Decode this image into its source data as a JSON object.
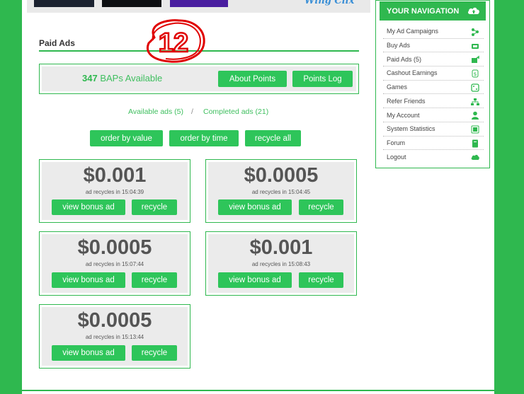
{
  "colors": {
    "brand": "#2fb84f",
    "button": "#2ec55a",
    "panel": "#ebebeb",
    "stamp": "#e00000"
  },
  "banner": {
    "logo_text": "Wing Clix"
  },
  "stamp_number": "12",
  "section": {
    "title": "Paid Ads"
  },
  "points": {
    "count": "347",
    "label": "BAPs Available",
    "about_button": "About Points",
    "log_button": "Points Log"
  },
  "filters": {
    "available": "Available ads (5)",
    "separator": "/",
    "completed": "Completed ads (21)"
  },
  "actions": {
    "order_value": "order by value",
    "order_time": "order by time",
    "recycle_all": "recycle all"
  },
  "ads": [
    {
      "value": "$0.001",
      "recycle_text": "ad recycles in 15:04:39",
      "view_label": "view bonus ad",
      "recycle_label": "recycle"
    },
    {
      "value": "$0.0005",
      "recycle_text": "ad recycles in 15:04:45",
      "view_label": "view bonus ad",
      "recycle_label": "recycle"
    },
    {
      "value": "$0.0005",
      "recycle_text": "ad recycles in 15:07:44",
      "view_label": "view bonus ad",
      "recycle_label": "recycle"
    },
    {
      "value": "$0.001",
      "recycle_text": "ad recycles in 15:08:43",
      "view_label": "view bonus ad",
      "recycle_label": "recycle"
    },
    {
      "value": "$0.0005",
      "recycle_text": "ad recycles in 15:13:44",
      "view_label": "view bonus ad",
      "recycle_label": "recycle"
    }
  ],
  "nav": {
    "header": "YOUR NAVIGATION",
    "items": [
      {
        "label": "My Ad Campaigns",
        "icon": "campaigns-icon"
      },
      {
        "label": "Buy Ads",
        "icon": "cart-icon"
      },
      {
        "label": "Paid Ads (5)",
        "icon": "share-icon"
      },
      {
        "label": "Cashout Earnings",
        "icon": "money-icon"
      },
      {
        "label": "Games",
        "icon": "dice-icon"
      },
      {
        "label": "Refer Friends",
        "icon": "network-icon"
      },
      {
        "label": "My Account",
        "icon": "user-icon"
      },
      {
        "label": "System Statistics",
        "icon": "stats-icon"
      },
      {
        "label": "Forum",
        "icon": "book-icon"
      },
      {
        "label": "Logout",
        "icon": "cloud-icon"
      }
    ]
  }
}
